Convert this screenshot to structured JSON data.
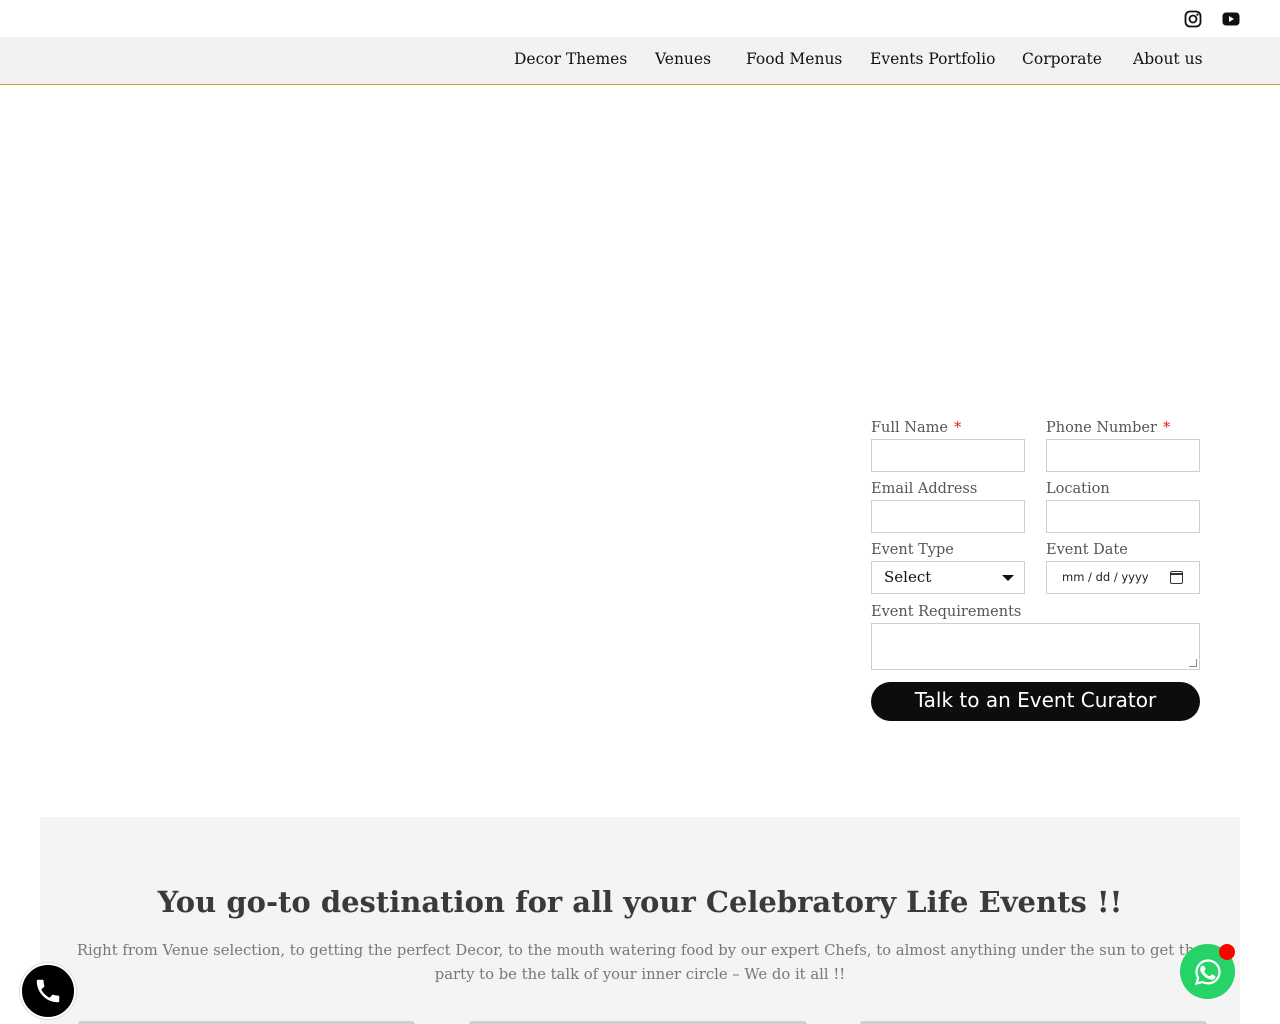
{
  "header": {
    "social": [
      {
        "icon": "instagram-icon"
      },
      {
        "icon": "youtube-icon"
      }
    ]
  },
  "nav": {
    "items": [
      {
        "label": "Decor Themes"
      },
      {
        "label": "Venues"
      },
      {
        "label": "Food Menus"
      },
      {
        "label": "Events Portfolio"
      },
      {
        "label": "Corporate"
      },
      {
        "label": "About us"
      }
    ]
  },
  "form": {
    "full_name_label": "Full Name",
    "phone_label": "Phone Number",
    "required_mark": "*",
    "email_label": "Email Address",
    "location_label": "Location",
    "event_type_label": "Event Type",
    "event_type_value": "Select",
    "event_date_label": "Event Date",
    "event_date_placeholder": "mm / dd / yyyy",
    "requirements_label": "Event Requirements",
    "submit_label": "Talk to an Event Curator"
  },
  "intro": {
    "title": "You go-to destination for all your Celebratory Life Events !!",
    "text": "Right from Venue selection, to getting the perfect Decor, to the mouth watering food by our expert Chefs, to almost anything under the sun to get the party to be the talk of your inner circle – We do it all !!"
  },
  "colors": {
    "accent": "#c9a227",
    "whatsapp": "#25d366",
    "notification": "#ff0000",
    "button": "#0d0d0d"
  }
}
